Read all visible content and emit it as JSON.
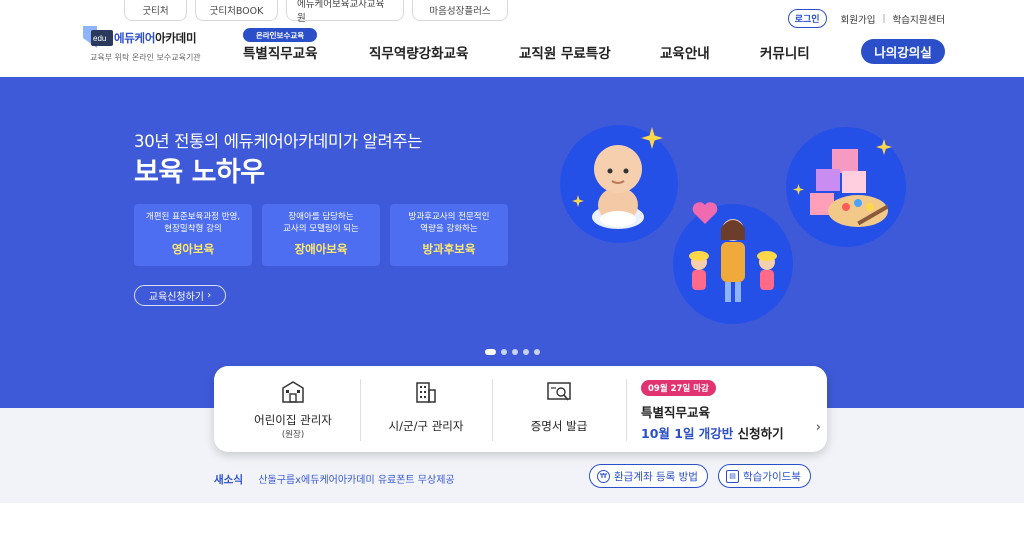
{
  "family_sites": [
    "굿티처",
    "굿티처BOOK",
    "에듀케어보육교사교육원",
    "마음성장플러스"
  ],
  "util": {
    "login": "로그인",
    "join": "회원가입",
    "sep": "|",
    "support": "학습지원센터"
  },
  "logo": {
    "mark_text": "edu",
    "brand_blue": "에듀케어",
    "brand_dark": "아카데미",
    "tagline": "교육부 위탁 온라인 보수교육기관"
  },
  "gnb": {
    "badge": "온라인보수교육",
    "items": [
      "특별직무교육",
      "직무역량강화교육",
      "교직원 무료특강",
      "교육안내",
      "커뮤니티"
    ],
    "my_class": "나의강의실"
  },
  "hero": {
    "sub": "30년 전통의 에듀케어아카데미가 알려주는",
    "title": "보육 노하우",
    "cards": [
      {
        "d1": "개편된 표준보육과정 반영,",
        "d2": "현장밀착형 강의",
        "name": "영아보육"
      },
      {
        "d1": "장애아를 담당하는",
        "d2": "교사의 모델링이 되는",
        "name": "장애아보육"
      },
      {
        "d1": "방과후교사의 전문적인",
        "d2": "역량을 강화하는",
        "name": "방과후보육"
      }
    ],
    "apply": "교육신청하기",
    "apply_chevron": "›",
    "slides": 5,
    "active_slide": 1
  },
  "quick": {
    "items": [
      {
        "label": "어린이집 관리자",
        "sub": "(원장)",
        "icon": "building-icon"
      },
      {
        "label": "시/군/구 관리자",
        "sub": "",
        "icon": "office-building-icon"
      },
      {
        "label": "증명서 발급",
        "sub": "",
        "icon": "certificate-icon"
      }
    ],
    "special": {
      "due": "09월 27일 마감",
      "line1": "특별직무교육",
      "line2_hl": "10월 1일 개강반",
      "line2_rest": " 신청하기",
      "chevron": "›"
    }
  },
  "notice": {
    "label": "새소식",
    "text": "산돌구름x에듀케어아카데미 유료폰트 무상제공"
  },
  "pills": [
    {
      "label": "환급계좌 등록 방법",
      "icon": "coin-icon"
    },
    {
      "label": "학습가이드북",
      "icon": "book-icon"
    }
  ],
  "colors": {
    "primary": "#2b4fc9",
    "hero_bg": "#3f5ad9",
    "card_bg": "#4d6ef0",
    "highlight": "#ffe86a",
    "deadline": "#e0336f"
  }
}
